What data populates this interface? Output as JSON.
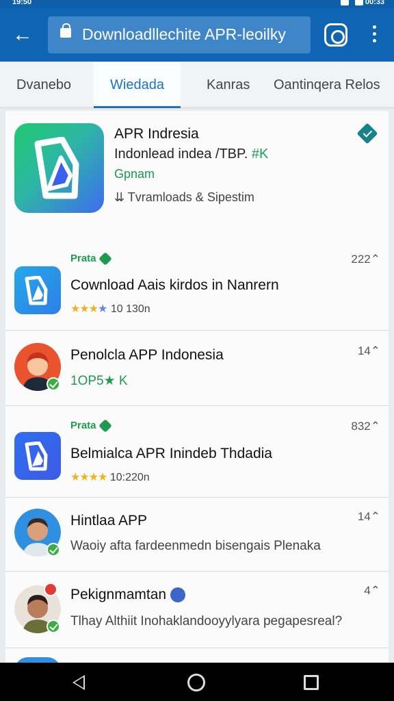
{
  "status": {
    "time": "19:50",
    "clock_right": "00:33"
  },
  "browser": {
    "url": "Downloadllechite APR-leoilky"
  },
  "tabs": [
    "Dvanebo",
    "Wiedada",
    "Kanras",
    "Oantinqera Relos"
  ],
  "active_tab": 1,
  "featured": {
    "title": "APR Indresia",
    "subtitle": "Indonlead indea /TBP.",
    "subtitle_accent": "#K",
    "tag": "Gpnam",
    "downloads": "Tvramloads & Sipestim"
  },
  "items": [
    {
      "label": "Prata",
      "count": "222",
      "title": "Cownload Aais kirdos in Nanrern",
      "stars": "★★★",
      "star_extra": "★",
      "rating_text": "10 130n"
    },
    {
      "count": "14",
      "title": "Penolcla APP Indonesia",
      "sub": "1OP5★ K"
    },
    {
      "label": "Prata",
      "count": "832",
      "title": "Belmialca APR Inindeb Thdadia",
      "stars": "★★★★",
      "rating_text": "10:220n"
    },
    {
      "count": "14",
      "title": "Hintlaa APP",
      "sub": "Waoiy afta fardeenmedn bisengais Plenaka"
    },
    {
      "count": "4",
      "title": "Pekignmamtan",
      "sub": "Tlhay Althiit Inohaklandooyylyara pegapesreal?"
    }
  ],
  "colors": {
    "appbar": "#0f65b4",
    "accent": "#1a73c8",
    "green": "#1d9b4e"
  }
}
